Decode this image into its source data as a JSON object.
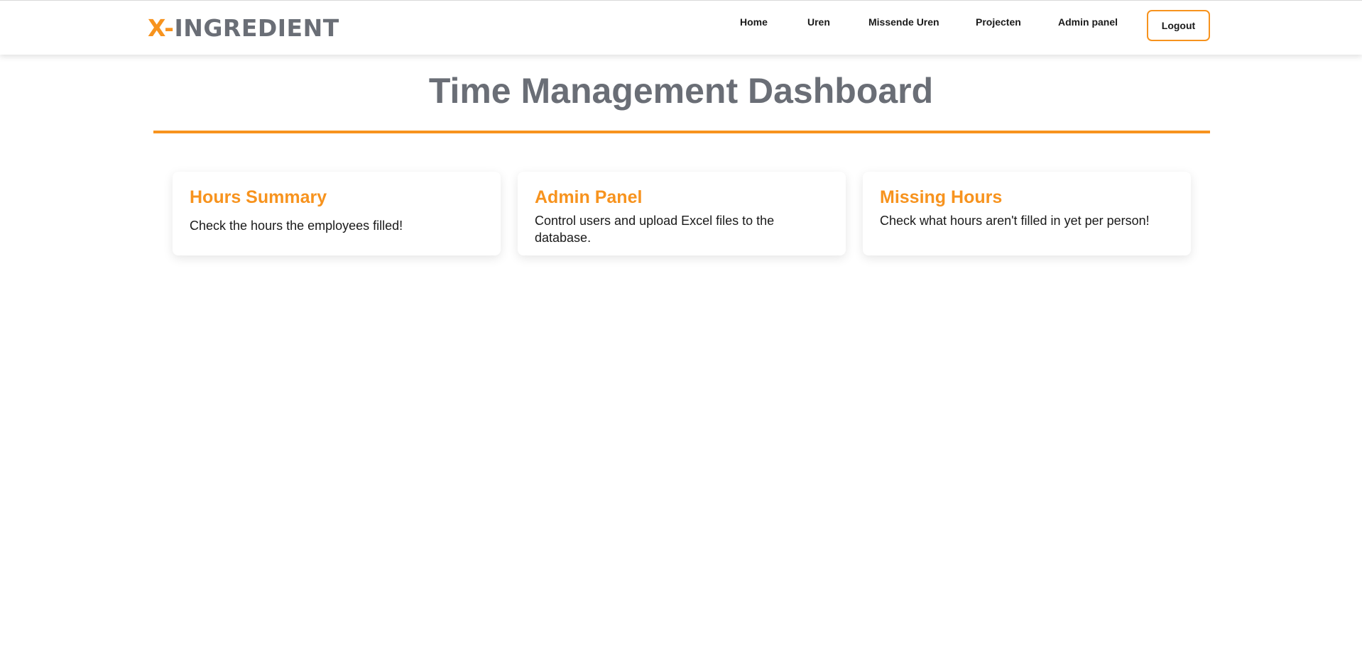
{
  "brand": {
    "logo_prefix": "X-",
    "logo_name": "INGREDIENT",
    "accent_color": "#f7931e",
    "text_color": "#6a6e76"
  },
  "nav": {
    "items": [
      {
        "label": "Home"
      },
      {
        "label": "Uren"
      },
      {
        "label": "Missende Uren"
      },
      {
        "label": "Projecten"
      },
      {
        "label": "Admin panel"
      }
    ],
    "logout_label": "Logout"
  },
  "main": {
    "title": "Time Management Dashboard",
    "cards": [
      {
        "title": "Hours Summary",
        "description": "Check the hours the employees filled!"
      },
      {
        "title": "Admin Panel",
        "description": "Control users and upload Excel files to the database."
      },
      {
        "title": "Missing Hours",
        "description": "Check what hours aren't filled in yet per person!"
      }
    ]
  }
}
